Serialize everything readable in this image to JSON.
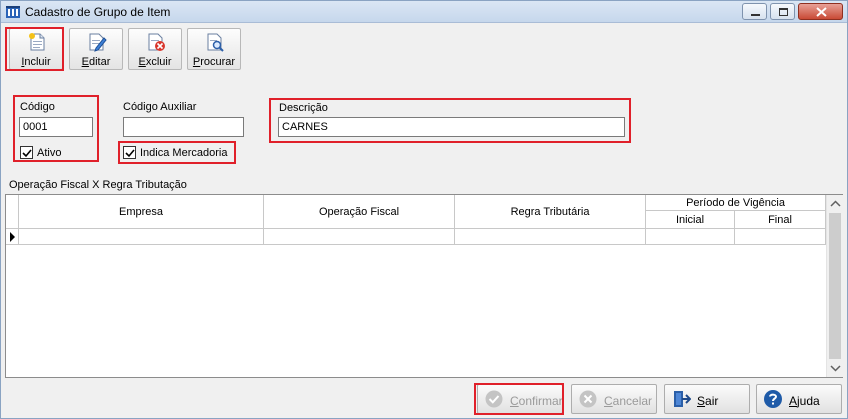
{
  "window": {
    "title": "Cadastro de Grupo de Item"
  },
  "toolbar": {
    "buttons": [
      {
        "label": "Incluir",
        "icon": "new-document-icon"
      },
      {
        "label": "Editar",
        "icon": "edit-pencil-icon"
      },
      {
        "label": "Excluir",
        "icon": "delete-document-icon"
      },
      {
        "label": "Procurar",
        "icon": "search-document-icon"
      }
    ]
  },
  "form": {
    "codigo_label": "Código",
    "codigo_value": "0001",
    "ativo_label": "Ativo",
    "ativo_checked": true,
    "codigo_aux_label": "Código Auxiliar",
    "codigo_aux_value": "",
    "indica_label": "Indica Mercadoria",
    "indica_checked": true,
    "descricao_label": "Descrição",
    "descricao_value": "CARNES"
  },
  "group": {
    "title": "Operação Fiscal X Regra Tributação"
  },
  "grid": {
    "columns": {
      "empresa": "Empresa",
      "operacao": "Operação Fiscal",
      "regra": "Regra Tributária",
      "periodo": "Período de Vigência",
      "inicial": "Inicial",
      "final": "Final"
    },
    "rows": [
      {
        "empresa": "",
        "operacao": "",
        "regra": "",
        "inicial": "",
        "final": ""
      }
    ]
  },
  "footer": {
    "confirmar": "Confirmar",
    "cancelar": "Cancelar",
    "sair": "Sair",
    "ajuda": "Ajuda"
  },
  "colors": {
    "highlight": "#e0202a",
    "title_bar": "#c6d7ec"
  }
}
